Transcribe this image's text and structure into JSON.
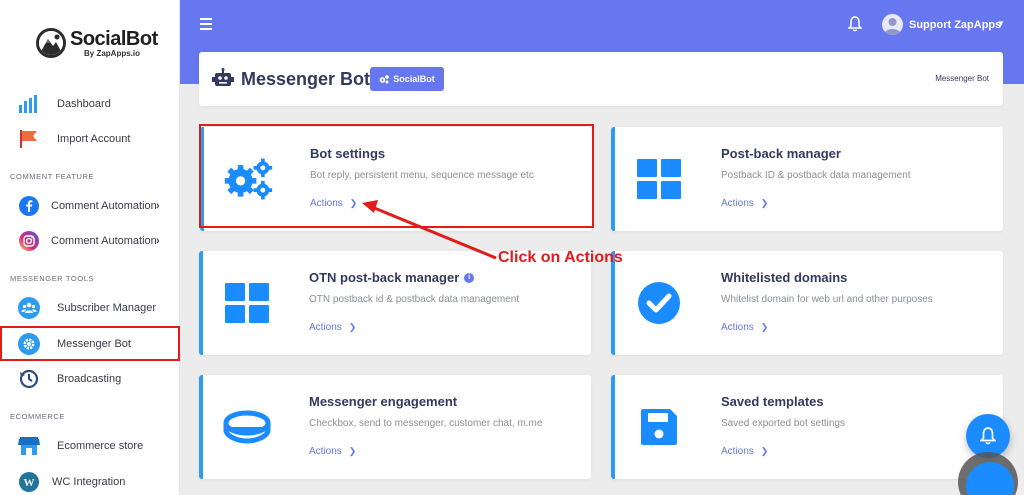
{
  "brand": {
    "name": "SocialBot",
    "sub": "By ZapApps.io"
  },
  "sidebar": {
    "items": [
      {
        "label": "Dashboard",
        "icon": "bar-chart-icon"
      },
      {
        "label": "Import Account",
        "icon": "flag-icon"
      },
      {
        "label": "Comment Automation",
        "icon": "facebook-icon"
      },
      {
        "label": "Comment Automation",
        "icon": "instagram-icon"
      },
      {
        "label": "Subscriber Manager",
        "icon": "users-icon"
      },
      {
        "label": "Messenger Bot",
        "icon": "gear-icon"
      },
      {
        "label": "Broadcasting",
        "icon": "history-icon"
      },
      {
        "label": "Ecommerce store",
        "icon": "store-icon"
      },
      {
        "label": "WC Integration",
        "icon": "wordpress-icon"
      }
    ],
    "sections": [
      "COMMENT FEATURE",
      "MESSENGER TOOLS",
      "ECOMMERCE"
    ]
  },
  "topbar": {
    "user_name": "Support ZapApps"
  },
  "header": {
    "title": "Messenger Bot",
    "badge": "SocialBot",
    "breadcrumb": "Messenger Bot"
  },
  "cards": [
    {
      "title": "Bot settings",
      "desc": "Bot reply, persistent menu, sequence message etc",
      "action": "Actions",
      "icon": "gears-icon"
    },
    {
      "title": "Post-back manager",
      "desc": "Postback ID & postback data management",
      "action": "Actions",
      "icon": "grid-icon"
    },
    {
      "title": "OTN post-back manager",
      "desc": "OTN postback id & postback data management",
      "action": "Actions",
      "icon": "grid-icon"
    },
    {
      "title": "Whitelisted domains",
      "desc": "Whitelist domain for web url and other purposes",
      "action": "Actions",
      "icon": "check-circle-icon"
    },
    {
      "title": "Messenger engagement",
      "desc": "Checkbox, send to messenger, customer chat, m.me",
      "action": "Actions",
      "icon": "ring-icon"
    },
    {
      "title": "Saved templates",
      "desc": "Saved exported bot settings",
      "action": "Actions",
      "icon": "save-icon"
    }
  ],
  "annotation": {
    "text": "Click on Actions"
  },
  "colors": {
    "primary": "#6777ef",
    "accent": "#2d9cf0",
    "highlight": "#e21b1b"
  }
}
